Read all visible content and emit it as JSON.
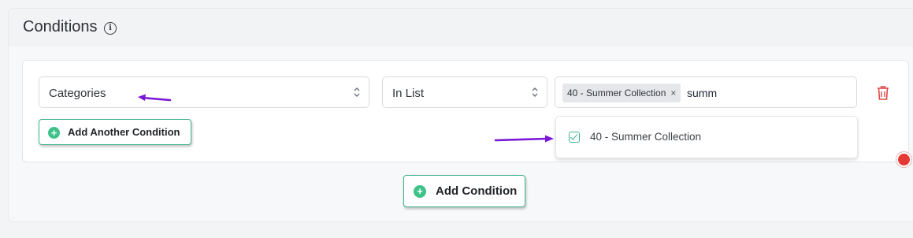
{
  "section": {
    "title": "Conditions",
    "info_icon": "info-icon"
  },
  "condition": {
    "field_select": {
      "value": "Categories"
    },
    "operator_select": {
      "value": "In List"
    },
    "values": {
      "selected_tags": [
        {
          "label": "40 - Summer Collection",
          "remove": "×"
        }
      ],
      "typed_text": "summ"
    },
    "dropdown": {
      "options": [
        {
          "label": "40 - Summer Collection",
          "checked": true
        }
      ]
    },
    "delete_icon": "trash-icon"
  },
  "buttons": {
    "add_another_condition": "Add Another Condition",
    "add_condition": "Add Condition"
  },
  "colors": {
    "accent_green": "#3eb489",
    "delete_red": "#e53935",
    "annotation_purple": "#7a16d8"
  }
}
